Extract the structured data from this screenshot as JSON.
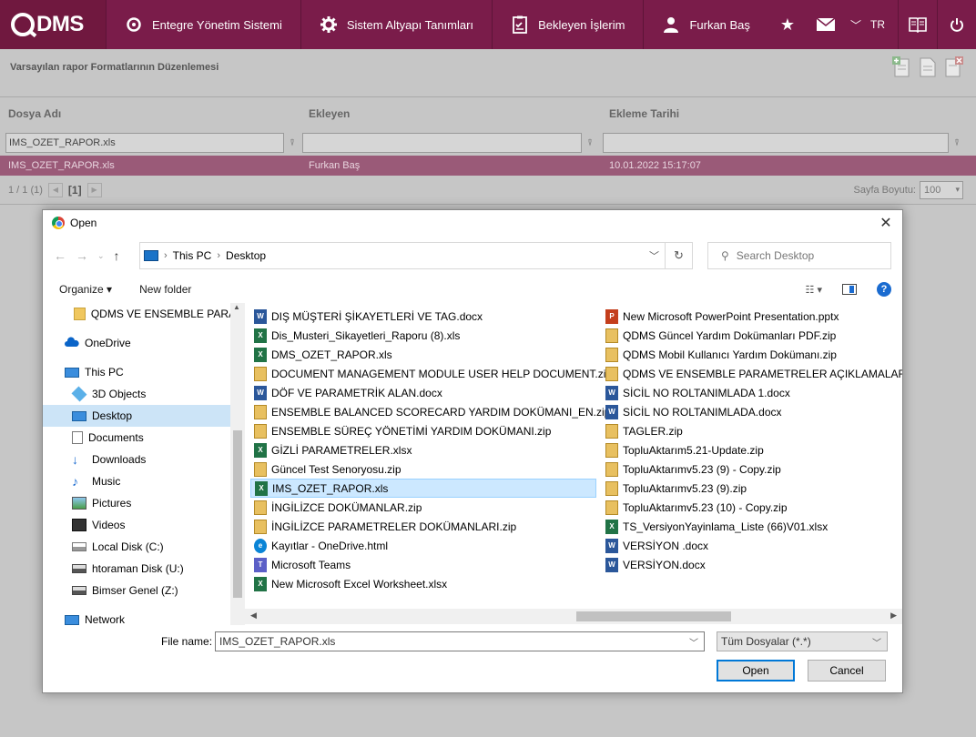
{
  "app": {
    "logo_text": "DMS",
    "nav": [
      {
        "label": "Entegre Yönetim Sistemi",
        "icon": "q-logo-icon"
      },
      {
        "label": "Sistem Altyapı Tanımları",
        "icon": "gear-icon"
      },
      {
        "label": "Bekleyen İşlerim",
        "icon": "task-list-icon"
      }
    ],
    "user": {
      "label": "Furkan Baş",
      "icon": "user-icon"
    },
    "lang": "TR",
    "top_icons": [
      "star-icon",
      "mail-icon",
      "chevron-down-icon",
      "book-icon",
      "power-icon"
    ],
    "brand_color": "#7a1c4a"
  },
  "page": {
    "title": "Varsayılan rapor Formatlarının Düzenlemesi",
    "action_icons": [
      "add-document-icon",
      "document-icon",
      "delete-document-icon"
    ]
  },
  "grid": {
    "columns": [
      "Dosya Adı",
      "Ekleyen",
      "Ekleme Tarihi"
    ],
    "filters": [
      "IMS_OZET_RAPOR.xls",
      "",
      ""
    ],
    "rows": [
      {
        "name": "IMS_OZET_RAPOR.xls",
        "added_by": "Furkan Baş",
        "date": "10.01.2022 15:17:07"
      }
    ],
    "pager": {
      "summary": "1 / 1 (1)",
      "current": "[1]",
      "page_size_label": "Sayfa Boyutu:",
      "page_size": "100"
    }
  },
  "dialog": {
    "title": "Open",
    "address": {
      "root": "This PC",
      "folder": "Desktop"
    },
    "search_placeholder": "Search Desktop",
    "toolbar": {
      "organize": "Organize",
      "new_folder": "New folder"
    },
    "nav_items": [
      {
        "label": "QDMS VE ENSEMBLE PARAM",
        "icon": "folder-icon",
        "indent": 1
      },
      {
        "label": "OneDrive",
        "icon": "cloud-icon",
        "indent": 0
      },
      {
        "label": "This PC",
        "icon": "computer-icon",
        "indent": 0
      },
      {
        "label": "3D Objects",
        "icon": "cube-icon",
        "indent": 1
      },
      {
        "label": "Desktop",
        "icon": "desktop-icon",
        "indent": 1,
        "selected": true
      },
      {
        "label": "Documents",
        "icon": "documents-icon",
        "indent": 1
      },
      {
        "label": "Downloads",
        "icon": "download-icon",
        "indent": 1
      },
      {
        "label": "Music",
        "icon": "music-icon",
        "indent": 1
      },
      {
        "label": "Pictures",
        "icon": "pictures-icon",
        "indent": 1
      },
      {
        "label": "Videos",
        "icon": "videos-icon",
        "indent": 1
      },
      {
        "label": "Local Disk (C:)",
        "icon": "disk-icon",
        "indent": 1
      },
      {
        "label": "htoraman Disk (U:)",
        "icon": "network-drive-icon",
        "indent": 1
      },
      {
        "label": "Bimser Genel (Z:)",
        "icon": "network-drive-icon",
        "indent": 1
      },
      {
        "label": "Network",
        "icon": "network-icon",
        "indent": 0
      }
    ],
    "files_left": [
      {
        "name": "DIŞ MÜŞTERİ ŞİKAYETLERİ VE TAG.docx",
        "type": "docx"
      },
      {
        "name": "Dis_Musteri_Sikayetleri_Raporu (8).xls",
        "type": "xls"
      },
      {
        "name": "DMS_OZET_RAPOR.xls",
        "type": "xls"
      },
      {
        "name": "DOCUMENT MANAGEMENT MODULE USER HELP DOCUMENT.zip",
        "type": "zip"
      },
      {
        "name": "DÖF VE PARAMETRİK ALAN.docx",
        "type": "docx"
      },
      {
        "name": "ENSEMBLE BALANCED SCORECARD YARDIM DOKÜMANI_EN.zip",
        "type": "zip"
      },
      {
        "name": "ENSEMBLE SÜREÇ YÖNETİMİ YARDIM DOKÜMANI.zip",
        "type": "zip"
      },
      {
        "name": "GİZLİ PARAMETRELER.xlsx",
        "type": "xls"
      },
      {
        "name": "Güncel Test Senoryosu.zip",
        "type": "zip"
      },
      {
        "name": "IMS_OZET_RAPOR.xls",
        "type": "xls",
        "selected": true
      },
      {
        "name": "İNGİLİZCE DOKÜMANLAR.zip",
        "type": "zip"
      },
      {
        "name": "İNGİLİZCE PARAMETRELER DOKÜMANLARI.zip",
        "type": "zip"
      },
      {
        "name": "Kayıtlar - OneDrive.html",
        "type": "html"
      },
      {
        "name": "Microsoft Teams",
        "type": "teams"
      },
      {
        "name": "New Microsoft Excel Worksheet.xlsx",
        "type": "xls"
      }
    ],
    "files_right": [
      {
        "name": "New Microsoft PowerPoint Presentation.pptx",
        "type": "pptx"
      },
      {
        "name": "QDMS Güncel Yardım Dokümanları PDF.zip",
        "type": "zip"
      },
      {
        "name": "QDMS Mobil Kullanıcı Yardım Dokümanı.zip",
        "type": "zip"
      },
      {
        "name": "QDMS VE ENSEMBLE PARAMETRELER AÇIKLAMALARI.zip",
        "type": "zip"
      },
      {
        "name": "SİCİL NO ROLTANIMLADA 1.docx",
        "type": "docx"
      },
      {
        "name": "SİCİL NO ROLTANIMLADA.docx",
        "type": "docx"
      },
      {
        "name": "TAGLER.zip",
        "type": "zip"
      },
      {
        "name": "TopluAktarım5.21-Update.zip",
        "type": "zip"
      },
      {
        "name": "TopluAktarımv5.23 (9) - Copy.zip",
        "type": "zip"
      },
      {
        "name": "TopluAktarımv5.23 (9).zip",
        "type": "zip"
      },
      {
        "name": "TopluAktarımv5.23 (10) - Copy.zip",
        "type": "zip"
      },
      {
        "name": "TS_VersiyonYayinlama_Liste (66)V01.xlsx",
        "type": "xls"
      },
      {
        "name": "VERSİYON .docx",
        "type": "docx"
      },
      {
        "name": "VERSİYON.docx",
        "type": "docx"
      }
    ],
    "file_name_label": "File name:",
    "file_name_value": "IMS_OZET_RAPOR.xls",
    "file_type": "Tüm Dosyalar (*.*)",
    "open_label": "Open",
    "cancel_label": "Cancel"
  }
}
